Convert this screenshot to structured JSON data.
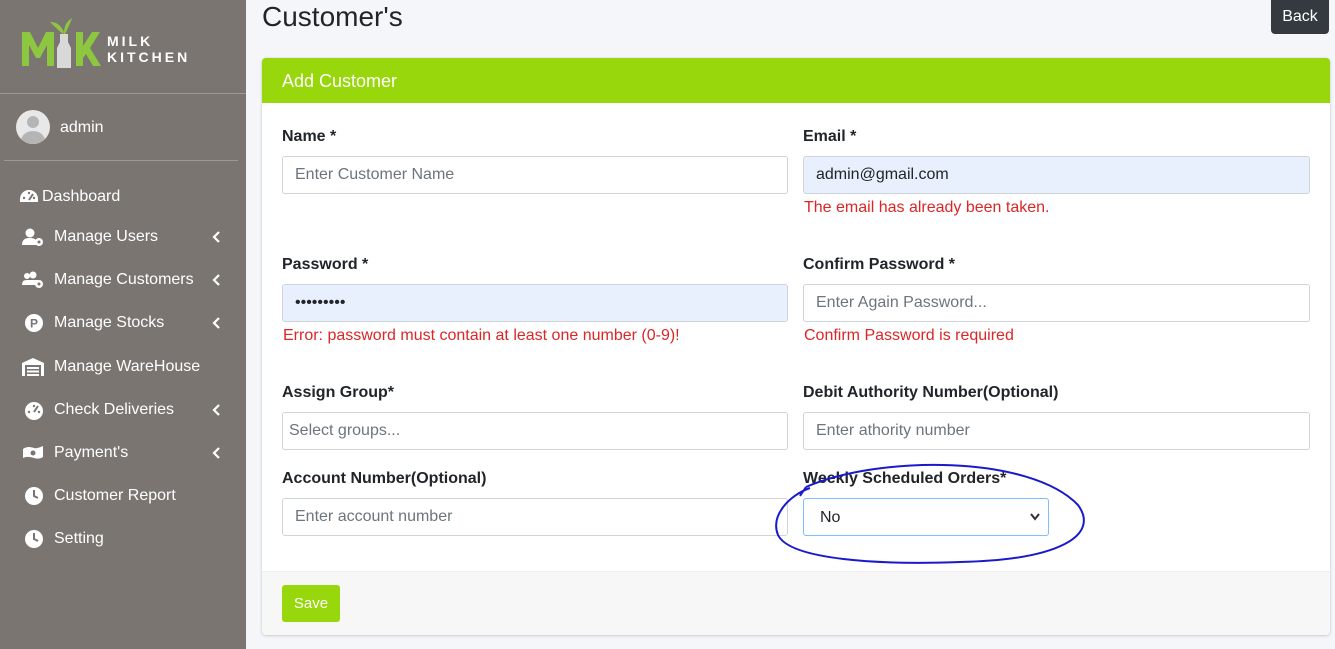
{
  "brand": {
    "line1": "MILK",
    "line2": "KITCHEN",
    "colors": {
      "logo_green": "#8dc63f",
      "logo_gray": "#d9d9d9"
    }
  },
  "user": {
    "name": "admin"
  },
  "sidebar": {
    "items": [
      {
        "label": "Dashboard",
        "icon": "tachometer-icon",
        "has_chevron": false
      },
      {
        "label": "Manage Users",
        "icon": "user-cog-icon",
        "has_chevron": true
      },
      {
        "label": "Manage Customers",
        "icon": "users-cog-icon",
        "has_chevron": true
      },
      {
        "label": "Manage Stocks",
        "icon": "parking-circle-icon",
        "has_chevron": true
      },
      {
        "label": "Manage WareHouse",
        "icon": "warehouse-icon",
        "has_chevron": false
      },
      {
        "label": "Check Deliveries",
        "icon": "tachometer-icon",
        "has_chevron": true
      },
      {
        "label": "Payment's",
        "icon": "money-icon",
        "has_chevron": true
      },
      {
        "label": "Customer Report",
        "icon": "clock-icon",
        "has_chevron": false
      },
      {
        "label": "Setting",
        "icon": "clock-icon",
        "has_chevron": false
      }
    ]
  },
  "header": {
    "title": "Customer's",
    "back_label": "Back"
  },
  "card": {
    "title": "Add Customer",
    "fields": {
      "name": {
        "label": "Name *",
        "placeholder": "Enter Customer Name",
        "value": ""
      },
      "email": {
        "label": "Email *",
        "value": "admin@gmail.com",
        "error": "The email has already been taken."
      },
      "password": {
        "label": "Password *",
        "value": "•••••••••",
        "error": "Error: password must contain at least one number (0-9)!"
      },
      "confirm_password": {
        "label": "Confirm Password *",
        "placeholder": "Enter Again Password...",
        "error": "Confirm Password is required"
      },
      "assign_group": {
        "label": "Assign Group*",
        "placeholder": "Select groups..."
      },
      "debit_authority": {
        "label": "Debit Authority Number(Optional)",
        "placeholder": "Enter athority number"
      },
      "account_number": {
        "label": "Account Number(Optional)",
        "placeholder": "Enter account number"
      },
      "weekly_orders": {
        "label": "Weekly Scheduled Orders*",
        "value": "No"
      }
    },
    "save_label": "Save"
  },
  "colors": {
    "accent": "#97d70b",
    "sidebar": "#7a7571",
    "error": "#dc2626",
    "annotation": "#1a1acc"
  }
}
